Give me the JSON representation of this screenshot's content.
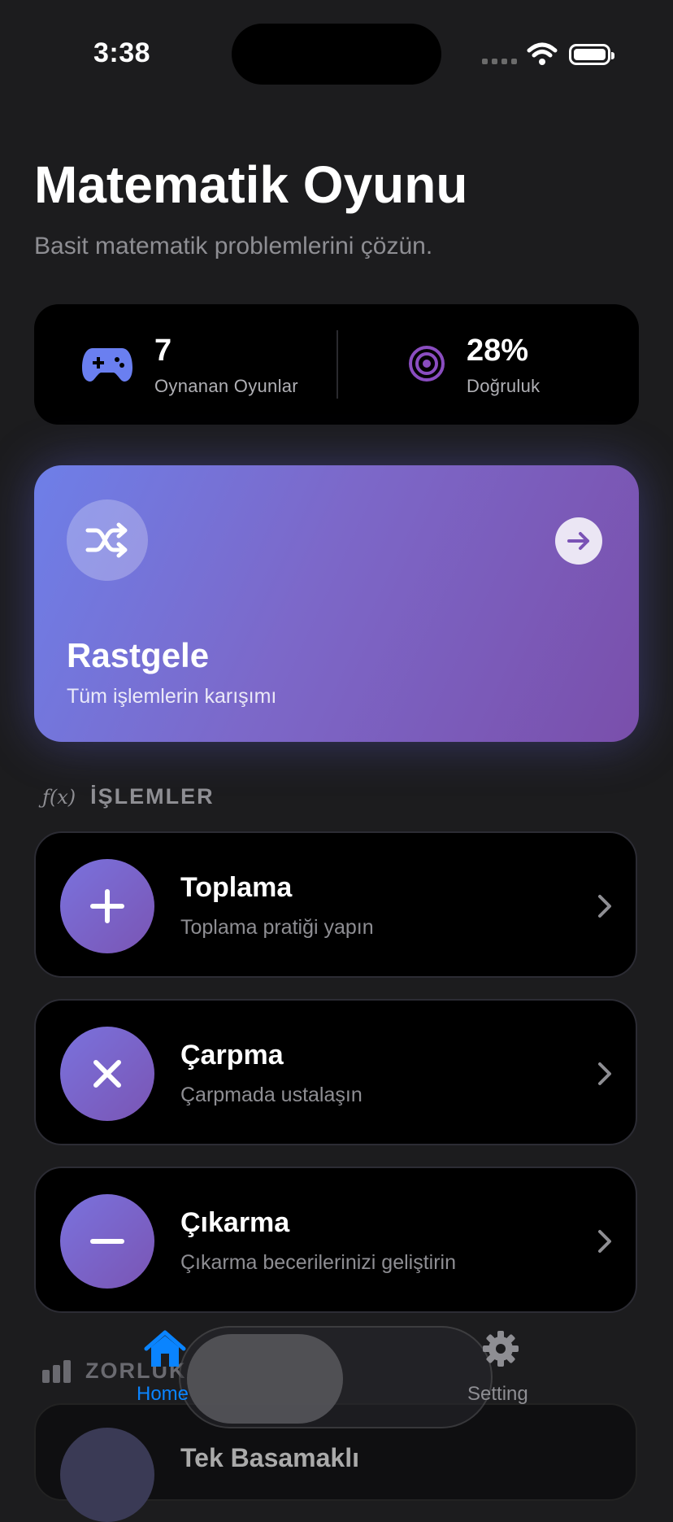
{
  "status_bar": {
    "time": "3:38"
  },
  "header": {
    "title": "Matematik Oyunu",
    "subtitle": "Basit matematik problemlerini çözün."
  },
  "stats": {
    "games_played": {
      "value": "7",
      "label": "Oynanan Oyunlar",
      "icon": "gamepad-icon"
    },
    "accuracy": {
      "value": "28%",
      "label": "Doğruluk",
      "icon": "target-icon"
    }
  },
  "random_card": {
    "title": "Rastgele",
    "subtitle": "Tüm işlemlerin karışımı",
    "icon": "shuffle-icon",
    "gradient": [
      "#6e7fe8",
      "#7a4fab"
    ]
  },
  "operations_section": {
    "label": "İŞLEMLER",
    "icon_text": "ƒ(x)",
    "items": [
      {
        "title": "Toplama",
        "subtitle": "Toplama pratiği yapın",
        "icon": "plus-icon"
      },
      {
        "title": "Çarpma",
        "subtitle": "Çarpmada ustalaşın",
        "icon": "multiply-icon"
      },
      {
        "title": "Çıkarma",
        "subtitle": "Çıkarma becerilerinizi geliştirin",
        "icon": "minus-icon"
      }
    ]
  },
  "difficulty_section": {
    "label": "ZORLUK",
    "items": [
      {
        "title": "Tek Basamaklı"
      }
    ]
  },
  "tab_bar": {
    "tabs": [
      {
        "label": "Home",
        "icon": "house-icon",
        "active": true
      },
      {
        "label": "Setting",
        "icon": "gear-icon",
        "active": false
      }
    ]
  },
  "colors": {
    "accent": "#0a84ff",
    "card_bg": "#000000",
    "background": "#1c1c1e"
  }
}
